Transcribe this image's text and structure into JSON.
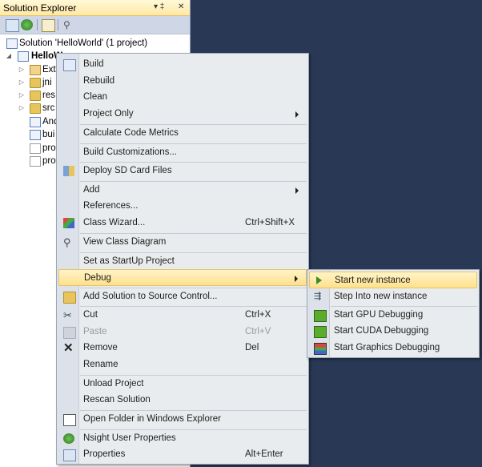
{
  "panel": {
    "title": "Solution Explorer",
    "pin_glyph": "▾ ‡",
    "close_glyph": "✕",
    "tree": [
      {
        "label": "Solution 'HelloWorld' (1 project)",
        "icon": "solution-icon",
        "bold": false
      },
      {
        "label": "HelloW",
        "icon": "project-icon",
        "bold": true
      },
      {
        "label": "Exte",
        "icon": "references-icon",
        "bold": false
      },
      {
        "label": "jni",
        "icon": "folder-icon",
        "bold": false
      },
      {
        "label": "res",
        "icon": "folder-icon",
        "bold": false
      },
      {
        "label": "src",
        "icon": "folder-icon",
        "bold": false
      },
      {
        "label": "And",
        "icon": "xml-file-icon",
        "bold": false
      },
      {
        "label": "bui",
        "icon": "xml-file-icon",
        "bold": false
      },
      {
        "label": "pro",
        "icon": "file-icon",
        "bold": false
      },
      {
        "label": "pro",
        "icon": "file-icon",
        "bold": false
      }
    ]
  },
  "context_menu": {
    "items": [
      {
        "label": "Build",
        "icon": "build-icon"
      },
      {
        "label": "Rebuild"
      },
      {
        "label": "Clean"
      },
      {
        "label": "Project Only",
        "submenu": true
      },
      {
        "label": "Calculate Code Metrics"
      },
      {
        "label": "Build Customizations..."
      },
      {
        "label": "Deploy SD Card Files",
        "icon": "deploy-icon"
      },
      {
        "label": "Add",
        "submenu": true
      },
      {
        "label": "References..."
      },
      {
        "label": "Class Wizard...",
        "shortcut": "Ctrl+Shift+X",
        "icon": "class-wizard-icon"
      },
      {
        "label": "View Class Diagram",
        "icon": "class-diagram-icon"
      },
      {
        "label": "Set as StartUp Project"
      },
      {
        "label": "Debug",
        "submenu": true,
        "highlighted": true
      },
      {
        "label": "Add Solution to Source Control...",
        "icon": "source-control-icon"
      },
      {
        "label": "Cut",
        "shortcut": "Ctrl+X",
        "icon": "scissors-icon"
      },
      {
        "label": "Paste",
        "shortcut": "Ctrl+V",
        "icon": "paste-icon",
        "disabled": true
      },
      {
        "label": "Remove",
        "shortcut": "Del",
        "icon": "remove-x-icon"
      },
      {
        "label": "Rename"
      },
      {
        "label": "Unload Project"
      },
      {
        "label": "Rescan Solution"
      },
      {
        "label": "Open Folder in Windows Explorer",
        "icon": "open-folder-icon"
      },
      {
        "label": "Nsight User Properties",
        "icon": "nsight-icon"
      },
      {
        "label": "Properties",
        "shortcut": "Alt+Enter",
        "icon": "properties-icon"
      }
    ]
  },
  "debug_submenu": {
    "items": [
      {
        "label": "Start new instance",
        "icon": "play-icon",
        "highlighted": true
      },
      {
        "label": "Step Into new instance",
        "icon": "step-into-icon"
      },
      {
        "label": "Start GPU Debugging",
        "icon": "gpu-debug-icon"
      },
      {
        "label": "Start CUDA Debugging",
        "icon": "cuda-debug-icon"
      },
      {
        "label": "Start Graphics Debugging",
        "icon": "graphics-debug-icon"
      }
    ]
  },
  "colors": {
    "background": "#293955",
    "menu_bg": "#e9ecee",
    "highlight": "#ffe18d",
    "play_green": "#3a8c2e"
  }
}
